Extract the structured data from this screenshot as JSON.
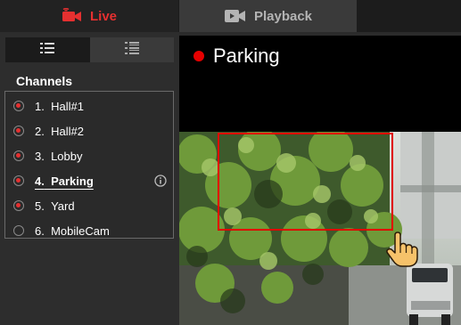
{
  "tabs": {
    "live": {
      "label": "Live",
      "icon": "live-camera-icon",
      "color": "#e53030"
    },
    "playback": {
      "label": "Playback",
      "icon": "video-camera-icon"
    }
  },
  "sidebar": {
    "view_toggle": [
      {
        "icon": "list-view-icon",
        "active": true
      },
      {
        "icon": "detail-list-icon",
        "active": false
      }
    ],
    "header": "Channels",
    "channels": [
      {
        "number": "1.",
        "name": "Hall#1",
        "active": true
      },
      {
        "number": "2.",
        "name": "Hall#2",
        "active": true
      },
      {
        "number": "3.",
        "name": "Lobby",
        "active": true
      },
      {
        "number": "4.",
        "name": "Parking",
        "active": true,
        "selected": true,
        "info_icon": "info-icon"
      },
      {
        "number": "5.",
        "name": "Yard",
        "active": true
      },
      {
        "number": "6.",
        "name": "MobileCam",
        "active": false
      }
    ]
  },
  "video": {
    "title": "Parking",
    "recording_indicator_color": "#e60000",
    "selection_color": "#e00000",
    "cursor_icon": "hand-pointer-icon"
  }
}
